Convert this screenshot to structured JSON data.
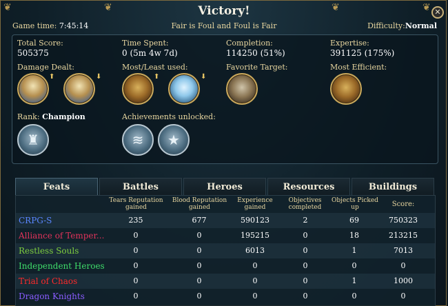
{
  "header": {
    "title": "Victory!",
    "game_time_label": "Game time:",
    "game_time_value": "7:45:14",
    "scenario": "Fair is Foul and Foul is Fair",
    "difficulty_label": "Difficulty:",
    "difficulty_value": "Normal"
  },
  "summary": {
    "total_score_label": "Total Score:",
    "total_score_value": "505375",
    "time_spent_label": "Time Spent:",
    "time_spent_value": "0 (5m 4w 7d)",
    "completion_label": "Completion:",
    "completion_value": "114250 (51%)",
    "expertise_label": "Expertise:",
    "expertise_value": "391125 (175%)",
    "damage_dealt_label": "Damage Dealt:",
    "most_least_used_label": "Most/Least used:",
    "favorite_target_label": "Favorite Target:",
    "most_efficient_label": "Most Efficient:",
    "rank_label": "Rank:",
    "rank_value": "Champion",
    "achievements_label": "Achievements unlocked:"
  },
  "tabs": [
    "Feats",
    "Battles",
    "Heroes",
    "Resources",
    "Buildings"
  ],
  "table": {
    "columns": [
      "Tears Reputation gained",
      "Blood Reputation gained",
      "Experience gained",
      "Objectives completed",
      "Objects Picked up",
      "Score:"
    ],
    "rows": [
      {
        "name": "CRPG-S",
        "color": "#5a86ff",
        "values": [
          "235",
          "677",
          "590123",
          "2",
          "69",
          "750323"
        ]
      },
      {
        "name": "Alliance of Temper...",
        "color": "#e0335a",
        "values": [
          "0",
          "0",
          "195215",
          "0",
          "18",
          "213215"
        ]
      },
      {
        "name": "Restless Souls",
        "color": "#7fcf3f",
        "values": [
          "0",
          "0",
          "6013",
          "0",
          "1",
          "7013"
        ]
      },
      {
        "name": "Independent Heroes",
        "color": "#3fdc6a",
        "values": [
          "0",
          "0",
          "0",
          "0",
          "0",
          "0"
        ]
      },
      {
        "name": "Trial of Chaos",
        "color": "#ff2a2a",
        "values": [
          "0",
          "0",
          "0",
          "0",
          "1",
          "1000"
        ]
      },
      {
        "name": "Dragon Knights",
        "color": "#8a5cff",
        "values": [
          "0",
          "0",
          "0",
          "0",
          "0",
          "0"
        ]
      }
    ]
  }
}
